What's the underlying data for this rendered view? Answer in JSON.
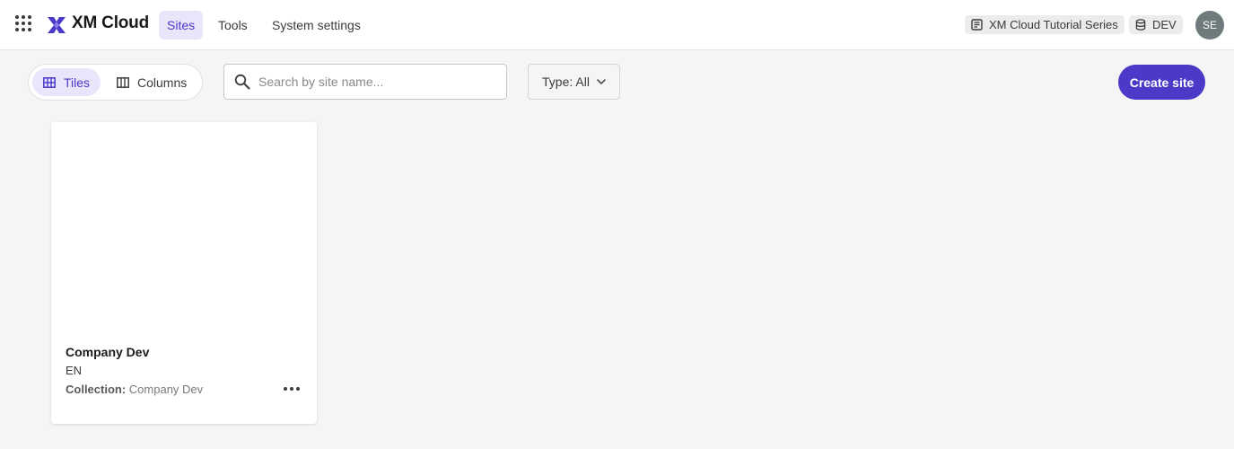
{
  "header": {
    "app_name": "XM Cloud",
    "nav": [
      {
        "label": "Sites",
        "active": true
      },
      {
        "label": "Tools",
        "active": false
      },
      {
        "label": "System settings",
        "active": false
      }
    ],
    "project": "XM Cloud Tutorial Series",
    "environment": "DEV",
    "user_initials": "SE"
  },
  "toolbar": {
    "view_tiles": "Tiles",
    "view_columns": "Columns",
    "active_view": "Tiles",
    "search_placeholder": "Search by site name...",
    "search_value": "",
    "type_filter_key": "Type:",
    "type_filter_value": "All",
    "create_label": "Create site"
  },
  "sites": [
    {
      "name": "Company Dev",
      "language": "EN",
      "collection_label": "Collection:",
      "collection": "Company Dev"
    }
  ],
  "colors": {
    "accent": "#4b39c7",
    "accent_soft": "#e9e5fb",
    "background": "#f5f5f5",
    "avatar": "#6e7a7b"
  },
  "icons": {
    "app_switcher": "grid-dots-icon",
    "logo": "xm-cloud-logo-icon",
    "project": "project-document-icon",
    "environment": "database-icon",
    "tiles": "tiles-grid-icon",
    "columns": "columns-icon",
    "search": "search-icon",
    "filter": "chevron-down-icon",
    "more": "more-horizontal-icon"
  }
}
